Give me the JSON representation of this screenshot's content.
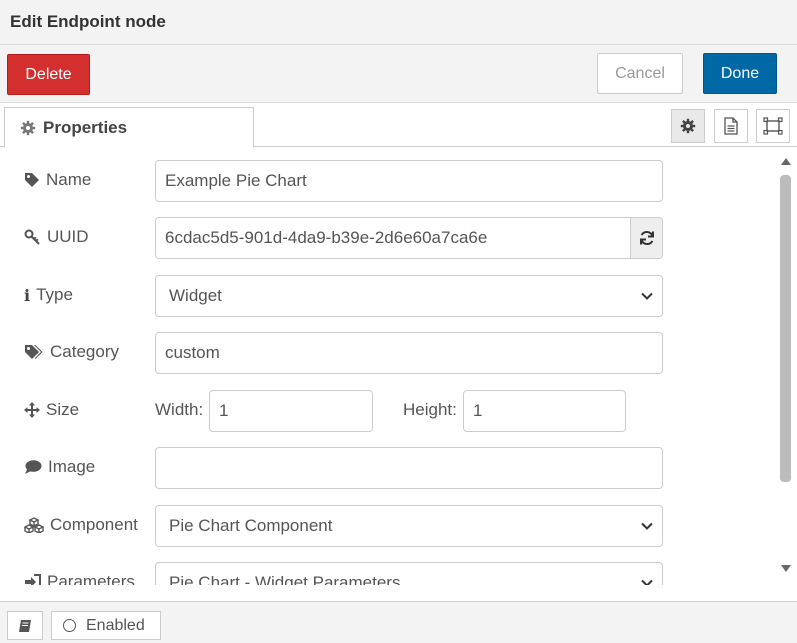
{
  "window": {
    "title": "Edit Endpoint node"
  },
  "toolbar": {
    "delete_label": "Delete",
    "cancel_label": "Cancel",
    "done_label": "Done"
  },
  "tabs": {
    "properties_label": "Properties"
  },
  "form": {
    "name": {
      "label": "Name",
      "value": "Example Pie Chart"
    },
    "uuid": {
      "label": "UUID",
      "value": "6cdac5d5-901d-4da9-b39e-2d6e60a7ca6e"
    },
    "type": {
      "label": "Type",
      "value": "Widget"
    },
    "category": {
      "label": "Category",
      "value": "custom"
    },
    "size": {
      "label": "Size",
      "width_label": "Width:",
      "width_value": "1",
      "height_label": "Height:",
      "height_value": "1"
    },
    "image": {
      "label": "Image",
      "value": ""
    },
    "component": {
      "label": "Component",
      "value": "Pie Chart Component"
    },
    "parameters": {
      "label": "Parameters",
      "value": "Pie Chart - Widget Parameters"
    }
  },
  "footer": {
    "enabled_label": "Enabled"
  },
  "colors": {
    "delete": "#d32f2f",
    "done": "#0168a6",
    "text": "#555555"
  }
}
